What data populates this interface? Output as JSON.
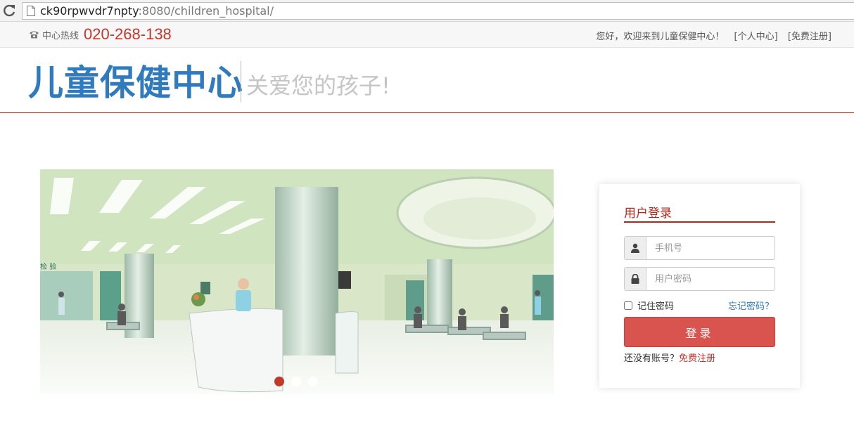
{
  "browser": {
    "url_host": "ck90rpwvdr7npty",
    "url_rest": ":8080/children_hospital/"
  },
  "topbar": {
    "hotline_label": "中心热线",
    "hotline_number": "020-268-138",
    "welcome_text": "您好，欢迎来到儿童保健中心！",
    "personal_center_link": "[个人中心]",
    "register_link": "[免费注册]"
  },
  "header": {
    "logo_text": "儿童保健中心",
    "slogan": "关爱您的孩子!"
  },
  "banner": {
    "slides": [
      "slide-1",
      "slide-2",
      "slide-3"
    ],
    "active_index": 0,
    "sign_text": "检 验"
  },
  "login": {
    "title": "用户登录",
    "phone_placeholder": "手机号",
    "password_placeholder": "用户密码",
    "remember_label": "记住密码",
    "forgot_link": "忘记密码？",
    "submit_label": "登录",
    "no_account_text": "还没有账号？",
    "register_link": "免费注册"
  },
  "colors": {
    "brand_blue": "#2f7bbd",
    "accent_red": "#b3271c",
    "button_red": "#d9534f"
  },
  "icons": {
    "phone": "phone-icon",
    "user": "user-icon",
    "lock": "lock-icon",
    "reload": "reload-icon",
    "page": "page-icon"
  }
}
